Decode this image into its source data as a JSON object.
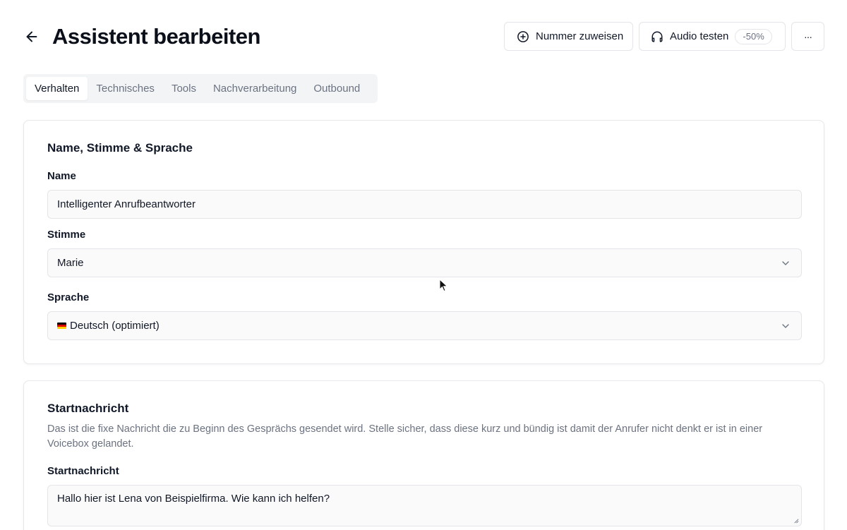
{
  "header": {
    "title": "Assistent bearbeiten",
    "assign_label": "Nummer zuweisen",
    "audio_label": "Audio testen",
    "audio_badge": "-50%",
    "more_label": "···"
  },
  "tabs": [
    {
      "label": "Verhalten",
      "active": true
    },
    {
      "label": "Technisches",
      "active": false
    },
    {
      "label": "Tools",
      "active": false
    },
    {
      "label": "Nachverarbeitung",
      "active": false
    },
    {
      "label": "Outbound",
      "active": false
    }
  ],
  "section1": {
    "title": "Name, Stimme & Sprache",
    "name_label": "Name",
    "name_value": "Intelligenter Anrufbeantworter",
    "voice_label": "Stimme",
    "voice_value": "Marie",
    "language_label": "Sprache",
    "language_value": "Deutsch (optimiert)"
  },
  "section2": {
    "title": "Startnachricht",
    "description": "Das ist die fixe Nachricht die zu Beginn des Gesprächs gesendet wird. Stelle sicher, dass diese kurz und bündig ist damit der Anrufer nicht denkt er ist in einer Voicebox gelandet.",
    "field_label": "Startnachricht",
    "field_value": "Hallo hier ist Lena von Beispielfirma. Wie kann ich helfen?"
  },
  "icons": {
    "back": "arrow-left-icon",
    "assign": "plus-circle-icon",
    "audio": "headphones-icon",
    "chevron": "chevron-down-icon",
    "flag": "german-flag-icon"
  }
}
